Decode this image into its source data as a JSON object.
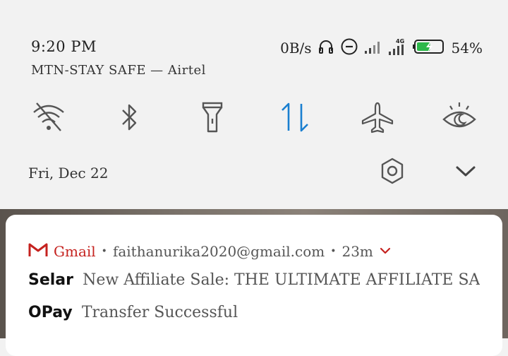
{
  "status_bar": {
    "time": "9:20 PM",
    "net_speed": "0B/s",
    "icons": [
      "headphones-icon",
      "do-not-disturb-icon",
      "signal-icon",
      "signal-4g-icon",
      "battery-charging-icon"
    ],
    "battery_percent": "54%",
    "battery_level": 0.54
  },
  "carrier": "MTN-STAY SAFE — Airtel",
  "quick_tiles": [
    {
      "name": "wifi",
      "icon": "wifi-off-icon",
      "active": false
    },
    {
      "name": "bluetooth",
      "icon": "bluetooth-icon",
      "active": false
    },
    {
      "name": "flashlight",
      "icon": "flashlight-icon",
      "active": false
    },
    {
      "name": "mobile-data",
      "icon": "mobile-data-icon",
      "active": true
    },
    {
      "name": "airplane-mode",
      "icon": "airplane-icon",
      "active": false
    },
    {
      "name": "reading-mode",
      "icon": "eye-icon",
      "active": false
    }
  ],
  "date": "Fri, Dec 22",
  "colors": {
    "accent": "#1a7fd0",
    "icon_inactive": "#555555",
    "gmail_red": "#c5221f",
    "battery_green": "#2db84a"
  },
  "notification": {
    "app_name": "Gmail",
    "separator": "•",
    "account": "faithanurika2020@gmail.com",
    "age": "23m",
    "messages": [
      {
        "sender": "Selar",
        "subject": "New Affiliate Sale: THE ULTIMATE AFFILIATE SAL..."
      },
      {
        "sender": "OPay",
        "subject": "Transfer Successful"
      }
    ]
  }
}
